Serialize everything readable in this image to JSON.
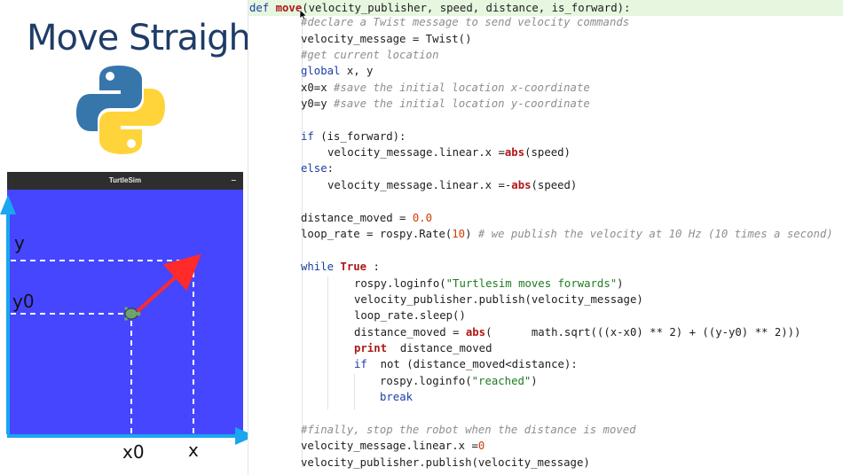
{
  "slide": {
    "title": "Move Straight",
    "logo_icon": "python-logo-icon"
  },
  "turtlesim": {
    "window_title": "TurtleSim",
    "minimize_label": "–",
    "background_color": "#4646fe",
    "axis_labels": {
      "y": "y",
      "y0": "y0",
      "x0": "x0",
      "x": "x"
    }
  },
  "code": {
    "l01": {
      "kw": "def ",
      "fn": "move",
      "rest": "(velocity_publisher, speed, distance, is_forward):"
    },
    "l02": {
      "comment": "#declare a Twist message to send velocity commands"
    },
    "l03": {
      "text": "velocity_message = Twist()"
    },
    "l04": {
      "comment": "#get current location"
    },
    "l05": {
      "kw": "global",
      "rest": " x, y"
    },
    "l06": {
      "text": "x0=x ",
      "comment": "#save the initial location x-coordinate"
    },
    "l07": {
      "text": "y0=y ",
      "comment": "#save the initial location y-coordinate"
    },
    "l09": {
      "kw": "if",
      "rest": " (is_forward):"
    },
    "l10": {
      "text": "velocity_message.linear.x =",
      "bi": "abs",
      "rest": "(speed)"
    },
    "l11": {
      "kw": "else",
      "rest": ":"
    },
    "l12": {
      "text": "velocity_message.linear.x =-",
      "bi": "abs",
      "rest": "(speed)"
    },
    "l14": {
      "text": "distance_moved = ",
      "num": "0.0"
    },
    "l15": {
      "text": "loop_rate = rospy.Rate(",
      "num": "10",
      "rest": ") ",
      "comment": "# we publish the velocity at 10 Hz (10 times a second)"
    },
    "l17": {
      "kw": "while",
      "kw2": " True",
      "rest": " :"
    },
    "l18": {
      "text": "rospy.loginfo(",
      "str": "\"Turtlesim moves forwards\"",
      "rest": ")"
    },
    "l19": {
      "text": "velocity_publisher.publish(velocity_message)"
    },
    "l20": {
      "text": "loop_rate.sleep()"
    },
    "l21": {
      "text": "distance_moved = ",
      "bi": "abs",
      "rest": "(      math.sqrt(((x-x0) ** 2) + ((y-y0) ** 2)))"
    },
    "l22": {
      "bi": "print",
      "rest": "  distance_moved"
    },
    "l23": {
      "kw": "if",
      "rest": "  not (distance_moved<distance):"
    },
    "l24": {
      "text": "rospy.loginfo(",
      "str": "\"reached\"",
      "rest": ")"
    },
    "l25": {
      "kw": "break"
    },
    "l27": {
      "comment": "#finally, stop the robot when the distance is moved"
    },
    "l28": {
      "text": "velocity_message.linear.x =",
      "num": "0"
    },
    "l29": {
      "text": "velocity_publisher.publish(velocity_message)"
    }
  }
}
